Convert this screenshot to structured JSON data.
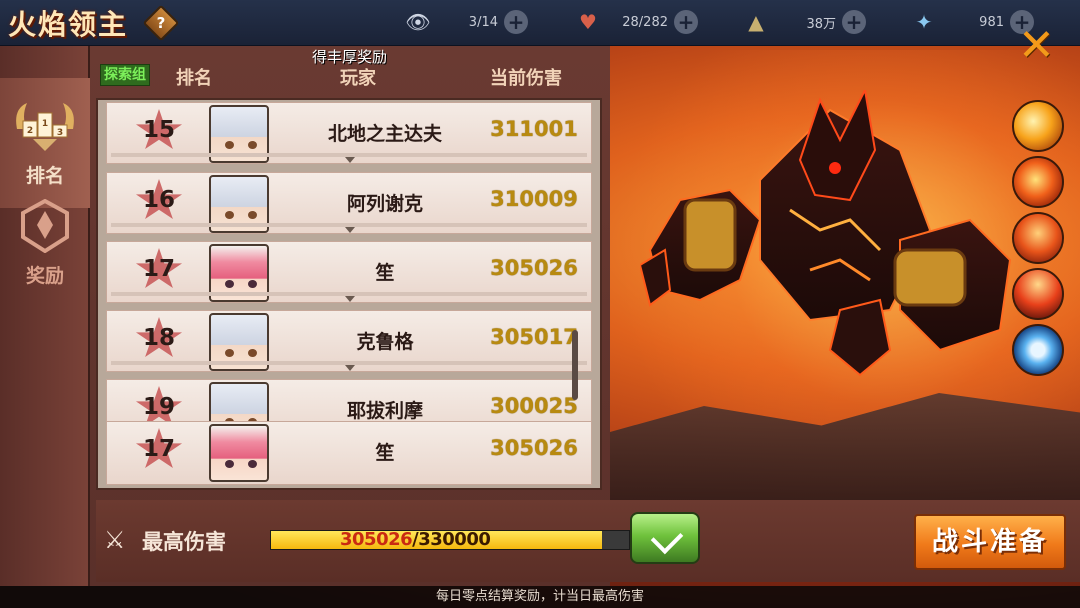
{
  "header": {
    "title": "火焰领主",
    "help_label": "?",
    "resources": [
      {
        "icon": "eye-icon",
        "value": "3/14"
      },
      {
        "icon": "heart-icon",
        "value": "28/282"
      },
      {
        "icon": "pyramid-icon",
        "value": "38万"
      },
      {
        "icon": "crystal-icon",
        "value": "981"
      }
    ],
    "plus_label": "+"
  },
  "sidebar": {
    "tabs": [
      {
        "label": "排名",
        "icon": "podium-icon",
        "active": true
      },
      {
        "label": "奖励",
        "icon": "emblem-icon",
        "active": false
      }
    ]
  },
  "banner_text": "得丰厚奖励",
  "table": {
    "badge": "探索组",
    "columns": {
      "rank": "排名",
      "player": "玩家",
      "damage": "当前伤害"
    },
    "rows": [
      {
        "rank": "15",
        "player": "北地之主达夫",
        "damage": "311001",
        "avatar": "white"
      },
      {
        "rank": "16",
        "player": "阿列谢克",
        "damage": "310009",
        "avatar": "white"
      },
      {
        "rank": "17",
        "player": "笙",
        "damage": "305026",
        "avatar": "pink"
      },
      {
        "rank": "18",
        "player": "克鲁格",
        "damage": "305017",
        "avatar": "white"
      },
      {
        "rank": "19",
        "player": "耶拔利摩",
        "damage": "300025",
        "avatar": "white"
      }
    ],
    "my_row": {
      "rank": "17",
      "player": "笙",
      "damage": "305026",
      "avatar": "pink"
    }
  },
  "max_damage": {
    "label": "最高伤害",
    "current": "305026",
    "target": "/330000",
    "progress": 0.924
  },
  "battle_button": "战斗准备",
  "footnote": "每日零点结算奖励，计当日最高伤害",
  "close_label": "✕",
  "skills": [
    "slash-skill-icon",
    "explosion-skill-icon",
    "fire-claw-skill-icon",
    "meteor-skill-icon",
    "vortex-skill-icon"
  ],
  "colors": {
    "accent": "#f07a1a",
    "damage_text": "#b88a10",
    "progress_fill": "#f5b80e"
  }
}
